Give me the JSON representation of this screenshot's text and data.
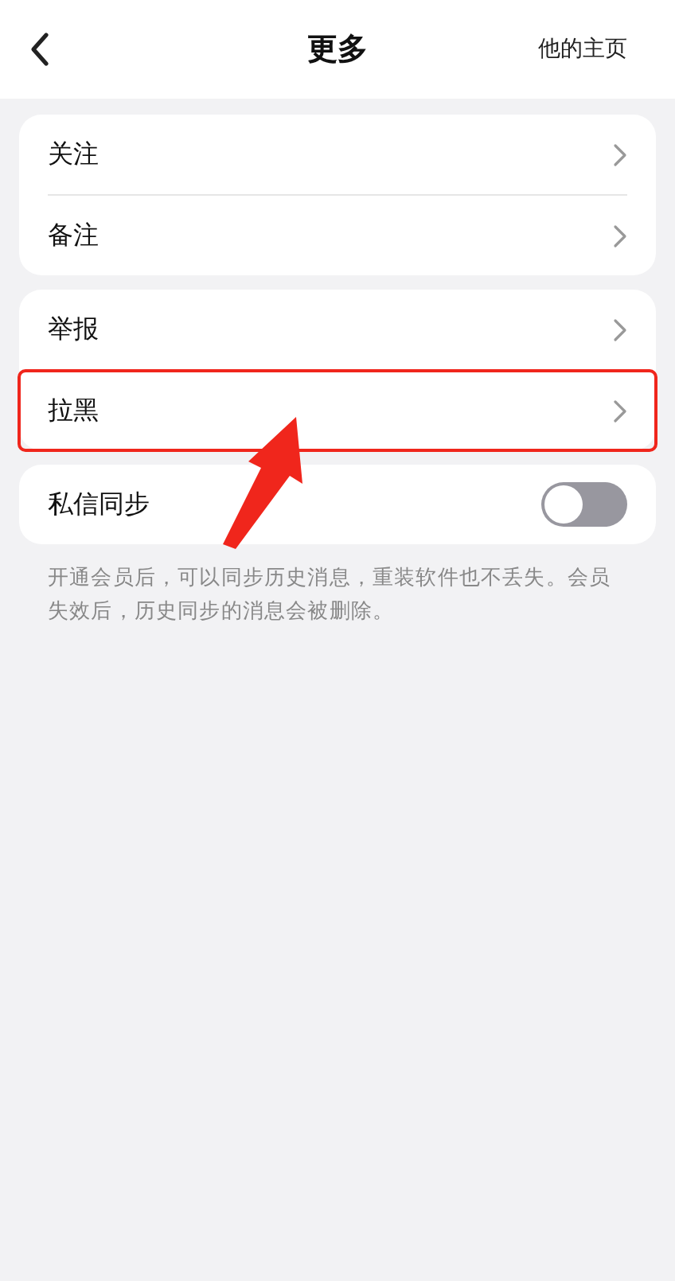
{
  "header": {
    "title": "更多",
    "action": "他的主页"
  },
  "groups": [
    {
      "rows": [
        {
          "kind": "link",
          "label": "关注",
          "highlighted": false
        },
        {
          "kind": "link",
          "label": "备注",
          "highlighted": false
        }
      ]
    },
    {
      "rows": [
        {
          "kind": "link",
          "label": "举报",
          "highlighted": false
        },
        {
          "kind": "link",
          "label": "拉黑",
          "highlighted": true
        }
      ]
    },
    {
      "rows": [
        {
          "kind": "toggle",
          "label": "私信同步",
          "on": false
        }
      ]
    }
  ],
  "footnote": "开通会员后，可以同步历史消息，重装软件也不丢失。会员失效后，历史同步的消息会被删除。"
}
